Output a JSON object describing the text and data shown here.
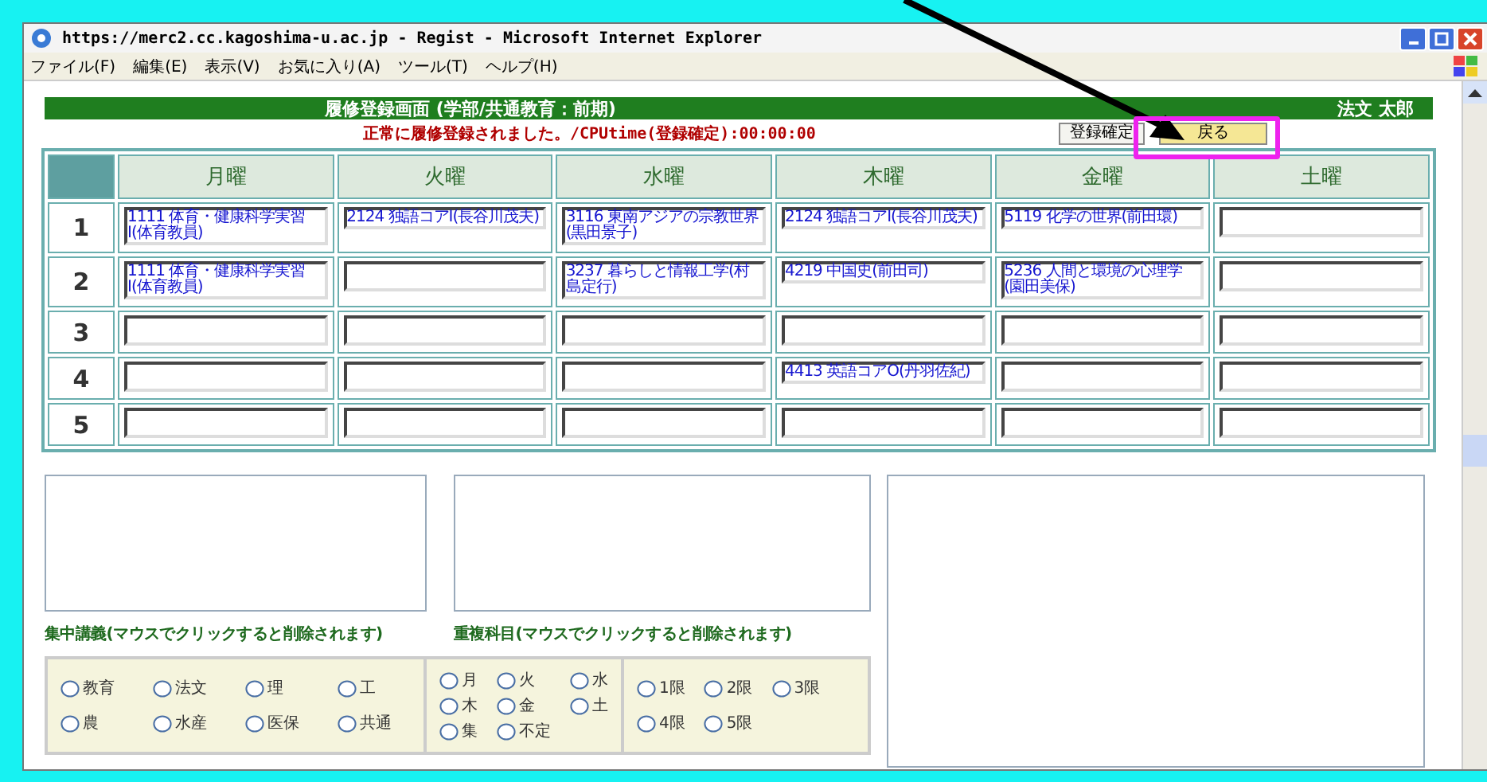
{
  "window": {
    "title": "https://merc2.cc.kagoshima-u.ac.jp - Regist - Microsoft Internet Explorer"
  },
  "menu": [
    "ファイル(F)",
    "編集(E)",
    "表示(V)",
    "お気に入り(A)",
    "ツール(T)",
    "ヘルプ(H)"
  ],
  "header": {
    "title": "履修登録画面 (学部/共通教育：前期)",
    "student": "法文 太郎"
  },
  "message": "正常に履修登録されました。/CPUtime(登録確定):00:00:00",
  "buttons": [
    {
      "label": "登録確定",
      "kind": "plain"
    },
    {
      "label": "戻る",
      "kind": "highlight"
    }
  ],
  "timetable": {
    "days": [
      "月曜",
      "火曜",
      "水曜",
      "木曜",
      "金曜",
      "土曜"
    ],
    "periods": [
      {
        "label": "1",
        "cells": [
          "1111 体育・健康科学実習Ⅰ(体育教員)",
          "2124 独語コアⅠ(長谷川茂夫)",
          "3116 東南アジアの宗教世界(黒田景子)",
          "2124 独語コアⅠ(長谷川茂夫)",
          "5119 化学の世界(前田環)",
          null
        ]
      },
      {
        "label": "2",
        "cells": [
          "1111 体育・健康科学実習Ⅰ(体育教員)",
          null,
          "3237 暮らしと情報工学(村島定行)",
          "4219 中国史(前田司)",
          "5236 人間と環境の心理学(園田美保)",
          null
        ]
      },
      {
        "label": "3",
        "cells": [
          null,
          null,
          null,
          null,
          null,
          null
        ]
      },
      {
        "label": "4",
        "cells": [
          null,
          null,
          null,
          "4413 英語コアO(丹羽佐紀)",
          null,
          null
        ]
      },
      {
        "label": "5",
        "cells": [
          null,
          null,
          null,
          null,
          null,
          null
        ]
      }
    ]
  },
  "lists": [
    {
      "caption": "集中講義(マウスでクリックすると削除されます)"
    },
    {
      "caption": "重複科目(マウスでクリックすると削除されます)"
    }
  ],
  "radio_groups": [
    {
      "options": [
        {
          "label": "教育",
          "selected": false
        },
        {
          "label": "法文",
          "selected": false
        },
        {
          "label": "理",
          "selected": false
        },
        {
          "label": "工",
          "selected": false
        },
        {
          "label": "農",
          "selected": false
        },
        {
          "label": "水産",
          "selected": false
        },
        {
          "label": "医保",
          "selected": false
        },
        {
          "label": "共通",
          "selected": false
        }
      ]
    },
    {
      "options": [
        {
          "label": "月",
          "selected": false
        },
        {
          "label": "火",
          "selected": false
        },
        {
          "label": "水",
          "selected": false
        },
        {
          "label": "木",
          "selected": false
        },
        {
          "label": "金",
          "selected": false
        },
        {
          "label": "土",
          "selected": false
        },
        {
          "label": "集",
          "selected": false
        },
        {
          "label": "不定",
          "selected": false
        }
      ]
    },
    {
      "options": [
        {
          "label": "1限",
          "selected": false
        },
        {
          "label": "2限",
          "selected": false
        },
        {
          "label": "3限",
          "selected": false
        },
        {
          "label": "4限",
          "selected": false
        },
        {
          "label": "5限",
          "selected": false
        }
      ]
    }
  ]
}
